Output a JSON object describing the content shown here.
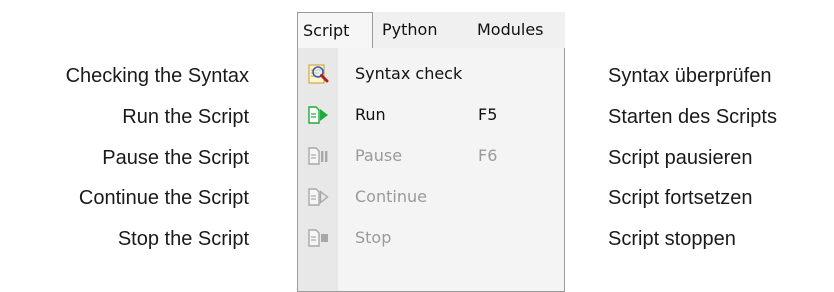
{
  "menubar": {
    "items": [
      {
        "label": "Script"
      },
      {
        "label": "Python"
      },
      {
        "label": "Modules"
      }
    ]
  },
  "menu": {
    "items": [
      {
        "label": "Syntax check",
        "shortcut": "",
        "icon": "syntax-check-icon",
        "enabled": true
      },
      {
        "label": "Run",
        "shortcut": "F5",
        "icon": "run-icon",
        "enabled": true
      },
      {
        "label": "Pause",
        "shortcut": "F6",
        "icon": "pause-icon",
        "enabled": false
      },
      {
        "label": "Continue",
        "shortcut": "",
        "icon": "continue-icon",
        "enabled": false
      },
      {
        "label": "Stop",
        "shortcut": "",
        "icon": "stop-icon",
        "enabled": false
      }
    ]
  },
  "annotations": {
    "english": [
      "Checking the Syntax",
      "Run the Script",
      "Pause the Script",
      "Continue the Script",
      "Stop the Script"
    ],
    "german": [
      "Syntax überprüfen",
      "Starten des Scripts",
      "Script pausieren",
      "Script fortsetzen",
      "Script stoppen"
    ]
  },
  "colors": {
    "run_green": "#1faa3c",
    "disabled_gray": "#a8a8a8",
    "menubar_bg": "#f0f0f0",
    "menu_bg": "#f4f4f4"
  }
}
